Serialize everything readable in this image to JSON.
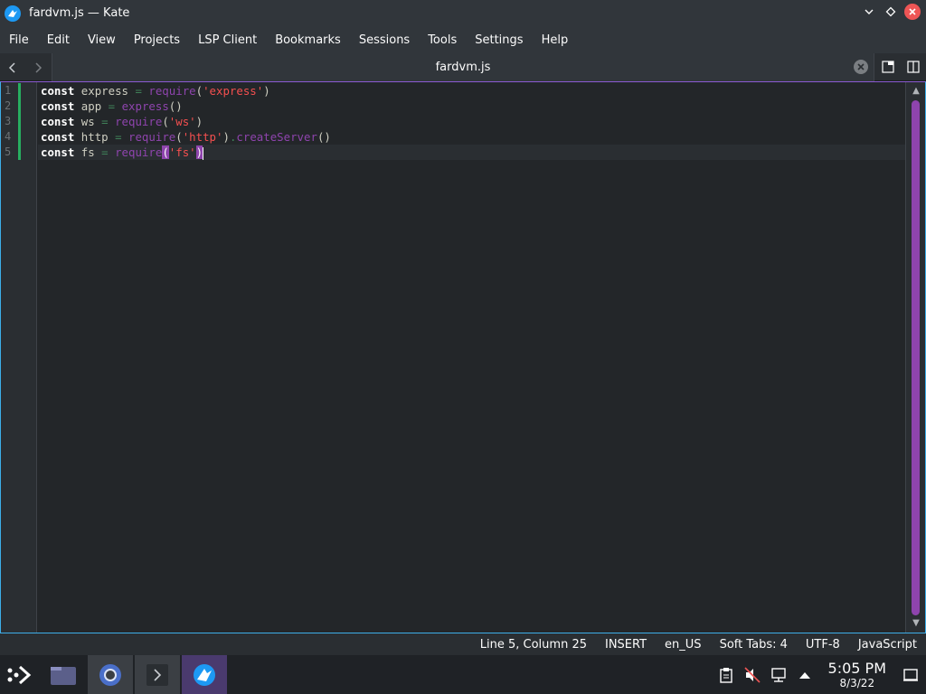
{
  "window": {
    "title": "fardvm.js — Kate"
  },
  "menu": {
    "items": [
      "File",
      "Edit",
      "View",
      "Projects",
      "LSP Client",
      "Bookmarks",
      "Sessions",
      "Tools",
      "Settings",
      "Help"
    ]
  },
  "tab": {
    "label": "fardvm.js"
  },
  "editor": {
    "line_numbers": [
      "1",
      "2",
      "3",
      "4",
      "5"
    ],
    "lines": [
      [
        {
          "t": "const",
          "c": "kw"
        },
        {
          "t": " express ",
          "c": ""
        },
        {
          "t": "=",
          "c": "op"
        },
        {
          "t": " ",
          "c": ""
        },
        {
          "t": "require",
          "c": "fn"
        },
        {
          "t": "(",
          "c": "brk"
        },
        {
          "t": "'express'",
          "c": "str"
        },
        {
          "t": ")",
          "c": "brk"
        }
      ],
      [
        {
          "t": "const",
          "c": "kw"
        },
        {
          "t": " app ",
          "c": ""
        },
        {
          "t": "=",
          "c": "op"
        },
        {
          "t": " ",
          "c": ""
        },
        {
          "t": "express",
          "c": "fn"
        },
        {
          "t": "()",
          "c": "brk"
        }
      ],
      [
        {
          "t": "const",
          "c": "kw"
        },
        {
          "t": " ws ",
          "c": ""
        },
        {
          "t": "=",
          "c": "op"
        },
        {
          "t": " ",
          "c": ""
        },
        {
          "t": "require",
          "c": "fn"
        },
        {
          "t": "(",
          "c": "brk"
        },
        {
          "t": "'ws'",
          "c": "str"
        },
        {
          "t": ")",
          "c": "brk"
        }
      ],
      [
        {
          "t": "const",
          "c": "kw"
        },
        {
          "t": " http ",
          "c": ""
        },
        {
          "t": "=",
          "c": "op"
        },
        {
          "t": " ",
          "c": ""
        },
        {
          "t": "require",
          "c": "fn"
        },
        {
          "t": "(",
          "c": "brk"
        },
        {
          "t": "'http'",
          "c": "str"
        },
        {
          "t": ")",
          "c": "brk"
        },
        {
          "t": ".",
          "c": "op"
        },
        {
          "t": "createServer",
          "c": "fn"
        },
        {
          "t": "()",
          "c": "brk"
        }
      ],
      [
        {
          "t": "const",
          "c": "kw"
        },
        {
          "t": " fs ",
          "c": ""
        },
        {
          "t": "=",
          "c": "op"
        },
        {
          "t": " ",
          "c": ""
        },
        {
          "t": "require",
          "c": "fn"
        },
        {
          "t": "(",
          "c": "brk-hl"
        },
        {
          "t": "'fs'",
          "c": "str"
        },
        {
          "t": ")",
          "c": "brk-hl"
        }
      ]
    ]
  },
  "status": {
    "position": "Line 5, Column 25",
    "mode": "INSERT",
    "dictionary": "en_US",
    "indent": "Soft Tabs: 4",
    "encoding": "UTF-8",
    "language": "JavaScript"
  },
  "taskbar": {
    "clock_time": "5:05 PM",
    "clock_date": "8/3/22"
  },
  "colors": {
    "accent": "#3daee9",
    "highlight": "#8e44ad",
    "close": "#ee5555",
    "modified": "#27ae60"
  }
}
